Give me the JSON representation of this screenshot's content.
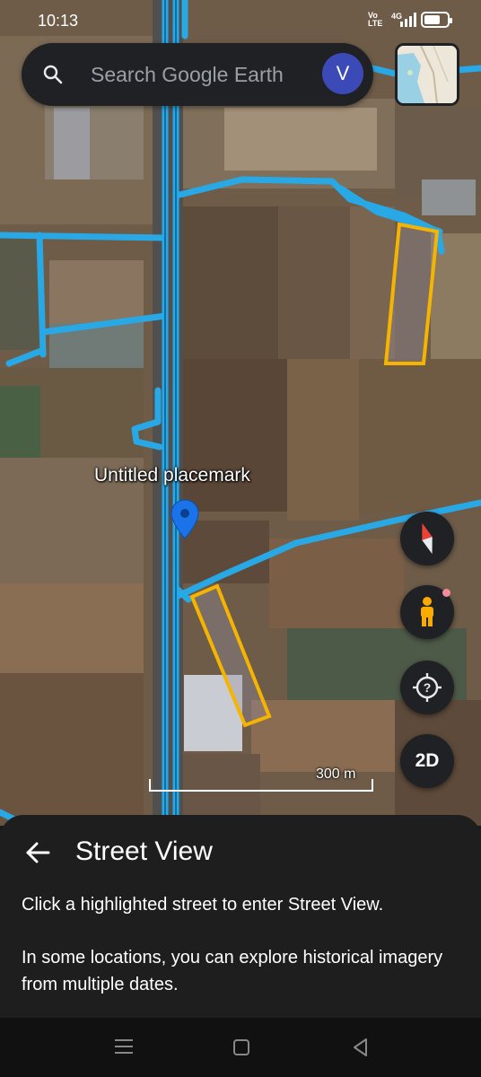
{
  "status_bar": {
    "time": "10:13",
    "network_top": "Vo",
    "network_bottom": "LTE",
    "network_type": "4G"
  },
  "search": {
    "placeholder": "Search Google Earth",
    "avatar_letter": "V"
  },
  "map": {
    "placemark_label": "Untitled placemark",
    "scale_label": "300 m",
    "highlight_color": "#29a8e6",
    "polygon_color": "#f5b400"
  },
  "controls": {
    "compass": "compass-icon",
    "street_view": "pegman-icon",
    "help_locate": "locate-help-icon",
    "view_mode_label": "2D"
  },
  "street_view_panel": {
    "title": "Street View",
    "instruction": "Click a highlighted street to enter Street View.",
    "info": "In some locations, you can explore historical imagery from multiple dates."
  },
  "nav_bar": {
    "menu": "menu-icon",
    "home": "home-icon",
    "back": "back-icon"
  }
}
